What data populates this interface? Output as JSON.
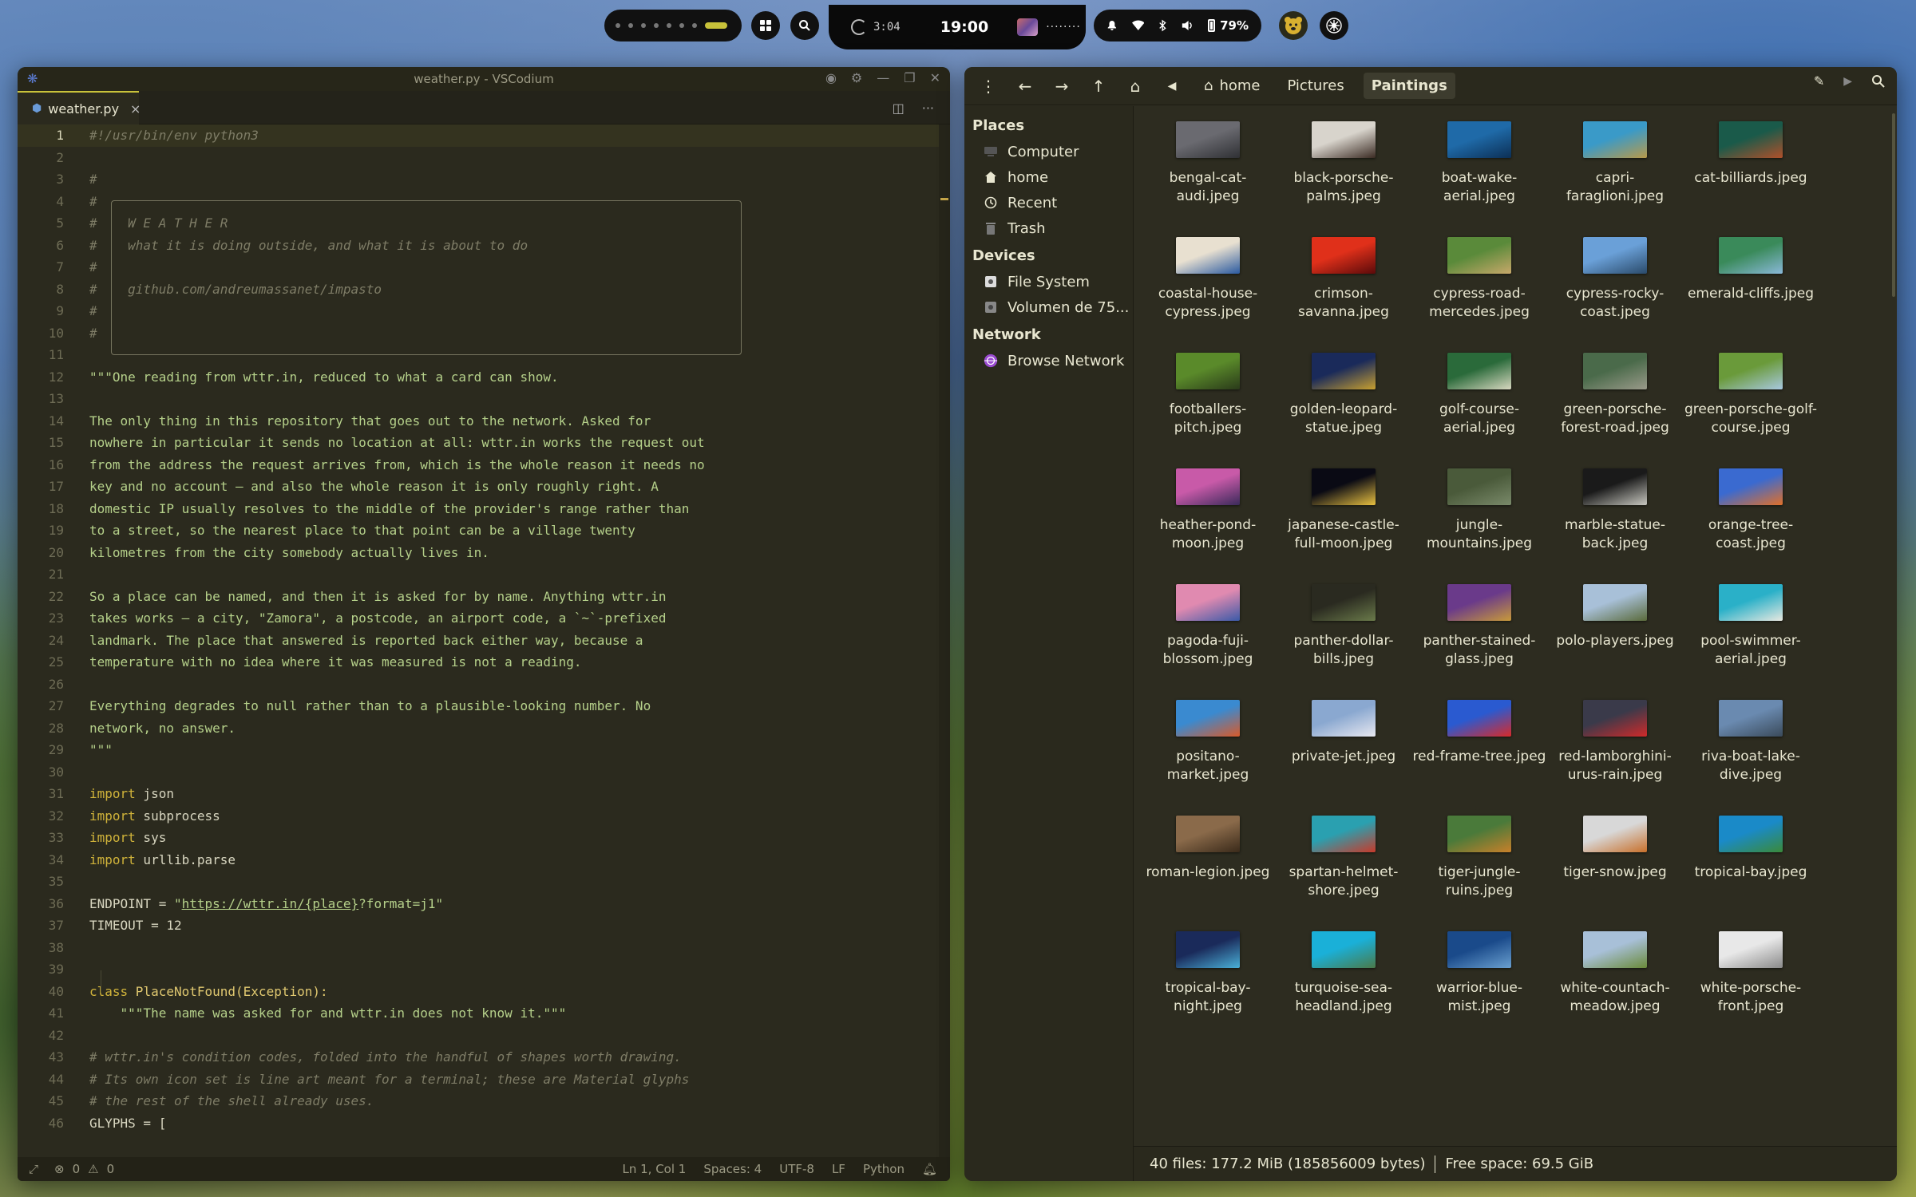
{
  "topbar": {
    "timer": "3:04",
    "clock": "19:00",
    "media_text": "········",
    "battery": "79%"
  },
  "vscode": {
    "title": "weather.py - VSCodium",
    "tab_label": "weather.py",
    "tab_close": "×",
    "status": {
      "errors": "0",
      "warnings": "0",
      "position": "Ln 1, Col 1",
      "spaces": "Spaces: 4",
      "encoding": "UTF-8",
      "eol": "LF",
      "language": "Python"
    },
    "lines": [
      {
        "n": "1",
        "parts": [
          [
            "#!/usr/bin/env python3",
            "com"
          ]
        ]
      },
      {
        "n": "2",
        "parts": []
      },
      {
        "n": "3",
        "parts": [
          [
            "#",
            "com"
          ]
        ]
      },
      {
        "n": "4",
        "parts": [
          [
            "#",
            "com"
          ]
        ]
      },
      {
        "n": "5",
        "parts": [
          [
            "#    W E A T H E R",
            "com"
          ]
        ]
      },
      {
        "n": "6",
        "parts": [
          [
            "#    what it is doing outside, and what it is about to do",
            "com"
          ]
        ]
      },
      {
        "n": "7",
        "parts": [
          [
            "#",
            "com"
          ]
        ]
      },
      {
        "n": "8",
        "parts": [
          [
            "#    github.com/andreumassanet/impasto",
            "com"
          ]
        ]
      },
      {
        "n": "9",
        "parts": [
          [
            "#",
            "com"
          ]
        ]
      },
      {
        "n": "10",
        "parts": [
          [
            "#",
            "com"
          ]
        ]
      },
      {
        "n": "11",
        "parts": []
      },
      {
        "n": "12",
        "parts": [
          [
            "\"\"\"One reading from wttr.in, reduced to what a card can show.",
            "doc"
          ]
        ]
      },
      {
        "n": "13",
        "parts": []
      },
      {
        "n": "14",
        "parts": [
          [
            "The only thing in this repository that goes out to the network. Asked for",
            "doc"
          ]
        ]
      },
      {
        "n": "15",
        "parts": [
          [
            "nowhere in particular it sends no location at all: wttr.in works the request out",
            "doc"
          ]
        ]
      },
      {
        "n": "16",
        "parts": [
          [
            "from the address the request arrives from, which is the whole reason it needs no",
            "doc"
          ]
        ]
      },
      {
        "n": "17",
        "parts": [
          [
            "key and no account — and also the whole reason it is only roughly right. A",
            "doc"
          ]
        ]
      },
      {
        "n": "18",
        "parts": [
          [
            "domestic IP usually resolves to the middle of the provider's range rather than",
            "doc"
          ]
        ]
      },
      {
        "n": "19",
        "parts": [
          [
            "to a street, so the nearest place to that point can be a village twenty",
            "doc"
          ]
        ]
      },
      {
        "n": "20",
        "parts": [
          [
            "kilometres from the city somebody actually lives in.",
            "doc"
          ]
        ]
      },
      {
        "n": "21",
        "parts": []
      },
      {
        "n": "22",
        "parts": [
          [
            "So a place can be named, and then it is asked for by name. Anything wttr.in",
            "doc"
          ]
        ]
      },
      {
        "n": "23",
        "parts": [
          [
            "takes works — a city, \"Zamora\", a postcode, an airport code, a `~`-prefixed",
            "doc"
          ]
        ]
      },
      {
        "n": "24",
        "parts": [
          [
            "landmark. The place that answered is reported back either way, because a",
            "doc"
          ]
        ]
      },
      {
        "n": "25",
        "parts": [
          [
            "temperature with no idea where it was measured is not a reading.",
            "doc"
          ]
        ]
      },
      {
        "n": "26",
        "parts": []
      },
      {
        "n": "27",
        "parts": [
          [
            "Everything degrades to null rather than to a plausible-looking number. No",
            "doc"
          ]
        ]
      },
      {
        "n": "28",
        "parts": [
          [
            "network, no answer.",
            "doc"
          ]
        ]
      },
      {
        "n": "29",
        "parts": [
          [
            "\"\"\"",
            "doc"
          ]
        ]
      },
      {
        "n": "30",
        "parts": []
      },
      {
        "n": "31",
        "parts": [
          [
            "import",
            "kw"
          ],
          [
            " json",
            "plain"
          ]
        ]
      },
      {
        "n": "32",
        "parts": [
          [
            "import",
            "kw"
          ],
          [
            " subprocess",
            "plain"
          ]
        ]
      },
      {
        "n": "33",
        "parts": [
          [
            "import",
            "kw"
          ],
          [
            " sys",
            "plain"
          ]
        ]
      },
      {
        "n": "34",
        "parts": [
          [
            "import",
            "kw"
          ],
          [
            " urllib.parse",
            "plain"
          ]
        ]
      },
      {
        "n": "35",
        "parts": []
      },
      {
        "n": "36",
        "parts": [
          [
            "ENDPOINT = ",
            "plain"
          ],
          [
            "\"",
            "str"
          ],
          [
            "https://wttr.in/{place}",
            "url"
          ],
          [
            "?format=j1\"",
            "str"
          ]
        ]
      },
      {
        "n": "37",
        "parts": [
          [
            "TIMEOUT = 12",
            "plain"
          ]
        ]
      },
      {
        "n": "38",
        "parts": []
      },
      {
        "n": "39",
        "parts": []
      },
      {
        "n": "40",
        "parts": [
          [
            "class",
            "kw"
          ],
          [
            " PlaceNotFound(Exception):",
            "cls"
          ]
        ]
      },
      {
        "n": "41",
        "parts": [
          [
            "    \"\"\"The name was asked for and wttr.in does not know it.\"\"\"",
            "doc"
          ]
        ]
      },
      {
        "n": "42",
        "parts": []
      },
      {
        "n": "43",
        "parts": [
          [
            "# wttr.in's condition codes, folded into the handful of shapes worth drawing.",
            "com"
          ]
        ]
      },
      {
        "n": "44",
        "parts": [
          [
            "# Its own icon set is line art meant for a terminal; these are Material glyphs",
            "com"
          ]
        ]
      },
      {
        "n": "45",
        "parts": [
          [
            "# the rest of the shell already uses.",
            "com"
          ]
        ]
      },
      {
        "n": "46",
        "parts": [
          [
            "GLYPHS = [",
            "plain"
          ]
        ]
      }
    ]
  },
  "files": {
    "breadcrumbs": [
      "home",
      "Pictures",
      "Paintings"
    ],
    "sidebar": {
      "places_label": "Places",
      "places": [
        "Computer",
        "home",
        "Recent",
        "Trash"
      ],
      "devices_label": "Devices",
      "devices": [
        "File System",
        "Volumen de 75..."
      ],
      "network_label": "Network",
      "network": [
        "Browse Network"
      ]
    },
    "items": [
      {
        "name": "bengal-cat-audi.jpeg",
        "c": [
          "#6a6a70",
          "#2f3034"
        ]
      },
      {
        "name": "black-porsche-palms.jpeg",
        "c": [
          "#d8d4cc",
          "#3a2a22"
        ]
      },
      {
        "name": "boat-wake-aerial.jpeg",
        "c": [
          "#1f6aa8",
          "#0c2f55"
        ]
      },
      {
        "name": "capri-faraglioni.jpeg",
        "c": [
          "#3a9ac8",
          "#b89a4a"
        ]
      },
      {
        "name": "cat-billiards.jpeg",
        "c": [
          "#1a5a4a",
          "#b0502a"
        ]
      },
      {
        "name": "coastal-house-cypress.jpeg",
        "c": [
          "#e8e0d0",
          "#2a5aa0"
        ]
      },
      {
        "name": "crimson-savanna.jpeg",
        "c": [
          "#e0301a",
          "#5a0a0a"
        ]
      },
      {
        "name": "cypress-road-mercedes.jpeg",
        "c": [
          "#5a8a3a",
          "#c8a86a"
        ]
      },
      {
        "name": "cypress-rocky-coast.jpeg",
        "c": [
          "#6aa0d8",
          "#2a4a6a"
        ]
      },
      {
        "name": "emerald-cliffs.jpeg",
        "c": [
          "#3a8a5a",
          "#8ab8d8"
        ]
      },
      {
        "name": "footballers-pitch.jpeg",
        "c": [
          "#5a8a2a",
          "#2a3a1a"
        ]
      },
      {
        "name": "golden-leopard-statue.jpeg",
        "c": [
          "#1a2a5a",
          "#c8a030"
        ]
      },
      {
        "name": "golf-course-aerial.jpeg",
        "c": [
          "#2a6a3a",
          "#d8d8c0"
        ]
      },
      {
        "name": "green-porsche-forest-road.jpeg",
        "c": [
          "#4a6a4a",
          "#9a9a8a"
        ]
      },
      {
        "name": "green-porsche-golf-course.jpeg",
        "c": [
          "#6a9a3a",
          "#a8c8e0"
        ]
      },
      {
        "name": "heather-pond-moon.jpeg",
        "c": [
          "#c85aa8",
          "#3a2a5a"
        ]
      },
      {
        "name": "japanese-castle-full-moon.jpeg",
        "c": [
          "#0a0a14",
          "#e8c040"
        ]
      },
      {
        "name": "jungle-mountains.jpeg",
        "c": [
          "#4a5a3a",
          "#7a8a6a"
        ]
      },
      {
        "name": "marble-statue-back.jpeg",
        "c": [
          "#1a1a1a",
          "#c8c8c0"
        ]
      },
      {
        "name": "orange-tree-coast.jpeg",
        "c": [
          "#3a6ad0",
          "#e0702a"
        ]
      },
      {
        "name": "pagoda-fuji-blossom.jpeg",
        "c": [
          "#e08ab0",
          "#3a5aa8"
        ]
      },
      {
        "name": "panther-dollar-bills.jpeg",
        "c": [
          "#2a2a20",
          "#6a7a4a"
        ]
      },
      {
        "name": "panther-stained-glass.jpeg",
        "c": [
          "#6a3a8a",
          "#c89a3a"
        ]
      },
      {
        "name": "polo-players.jpeg",
        "c": [
          "#a8c0d8",
          "#5a6a3a"
        ]
      },
      {
        "name": "pool-swimmer-aerial.jpeg",
        "c": [
          "#2ab0c8",
          "#e8e8e0"
        ]
      },
      {
        "name": "positano-market.jpeg",
        "c": [
          "#3a8ad0",
          "#d85a2a"
        ]
      },
      {
        "name": "private-jet.jpeg",
        "c": [
          "#8aa8d0",
          "#e8e8f0"
        ]
      },
      {
        "name": "red-frame-tree.jpeg",
        "c": [
          "#2a5ad0",
          "#d82a2a"
        ]
      },
      {
        "name": "red-lamborghini-urus-rain.jpeg",
        "c": [
          "#3a3a4a",
          "#d02a2a"
        ]
      },
      {
        "name": "riva-boat-lake-dive.jpeg",
        "c": [
          "#6a8ab0",
          "#3a4a5a"
        ]
      },
      {
        "name": "roman-legion.jpeg",
        "c": [
          "#8a6a4a",
          "#3a2a1a"
        ]
      },
      {
        "name": "spartan-helmet-shore.jpeg",
        "c": [
          "#2aa0b0",
          "#c83a2a"
        ]
      },
      {
        "name": "tiger-jungle-ruins.jpeg",
        "c": [
          "#4a7a3a",
          "#c8802a"
        ]
      },
      {
        "name": "tiger-snow.jpeg",
        "c": [
          "#d8d8d8",
          "#c8702a"
        ]
      },
      {
        "name": "tropical-bay.jpeg",
        "c": [
          "#1a8ac8",
          "#3a8a3a"
        ]
      },
      {
        "name": "tropical-bay-night.jpeg",
        "c": [
          "#1a2a5a",
          "#4ab0d8"
        ]
      },
      {
        "name": "turquoise-sea-headland.jpeg",
        "c": [
          "#1ab0d8",
          "#4a7a4a"
        ]
      },
      {
        "name": "warrior-blue-mist.jpeg",
        "c": [
          "#1a4a8a",
          "#6aa0d0"
        ]
      },
      {
        "name": "white-countach-meadow.jpeg",
        "c": [
          "#a8c0d8",
          "#6a8a3a"
        ]
      },
      {
        "name": "white-porsche-front.jpeg",
        "c": [
          "#e8e8e8",
          "#8a8a8a"
        ]
      }
    ],
    "status": {
      "summary": "40 files: 177.2 MiB (185856009 bytes)",
      "free": "Free space: 69.5 GiB"
    }
  }
}
